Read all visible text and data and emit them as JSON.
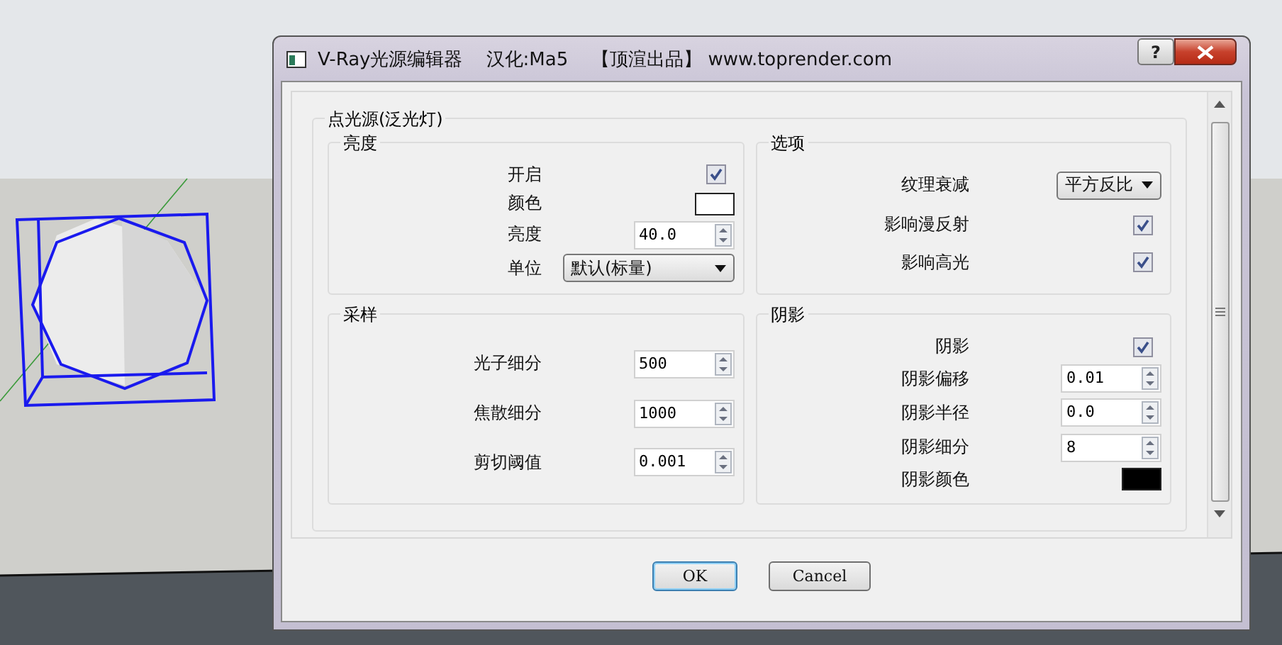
{
  "window": {
    "title": "V-Ray光源编辑器    汉化:Ma5    【顶渲出品】 www.toprender.com",
    "help_label": "?"
  },
  "group": {
    "title": "点光源(泛光灯)",
    "sections": [
      {
        "title": "亮度",
        "rows": [
          {
            "kind": "checkbox",
            "label": "开启",
            "checked": true
          },
          {
            "kind": "color",
            "label": "颜色",
            "color": "#ffffff"
          },
          {
            "kind": "spinner",
            "label": "亮度",
            "value": "40.0"
          },
          {
            "kind": "dropdown",
            "label": "单位",
            "value": "默认(标量)"
          }
        ]
      },
      {
        "title": "选项",
        "rows": [
          {
            "kind": "dropdown",
            "label": "纹理衰减",
            "value": "平方反比"
          },
          {
            "kind": "checkbox",
            "label": "影响漫反射",
            "checked": true
          },
          {
            "kind": "checkbox",
            "label": "影响高光",
            "checked": true
          }
        ]
      },
      {
        "title": "采样",
        "rows": [
          {
            "kind": "spinner",
            "label": "光子细分",
            "value": "500"
          },
          {
            "kind": "spinner",
            "label": "焦散细分",
            "value": "1000"
          },
          {
            "kind": "spinner",
            "label": "剪切阈值",
            "value": "0.001"
          }
        ]
      },
      {
        "title": "阴影",
        "rows": [
          {
            "kind": "checkbox",
            "label": "阴影",
            "checked": true
          },
          {
            "kind": "spinner",
            "label": "阴影偏移",
            "value": "0.01"
          },
          {
            "kind": "spinner",
            "label": "阴影半径",
            "value": "0.0"
          },
          {
            "kind": "spinner",
            "label": "阴影细分",
            "value": "8"
          },
          {
            "kind": "color",
            "label": "阴影颜色",
            "color": "#000000"
          }
        ]
      }
    ]
  },
  "buttons": [
    {
      "label": "OK",
      "default": true
    },
    {
      "label": "Cancel",
      "default": false
    }
  ]
}
